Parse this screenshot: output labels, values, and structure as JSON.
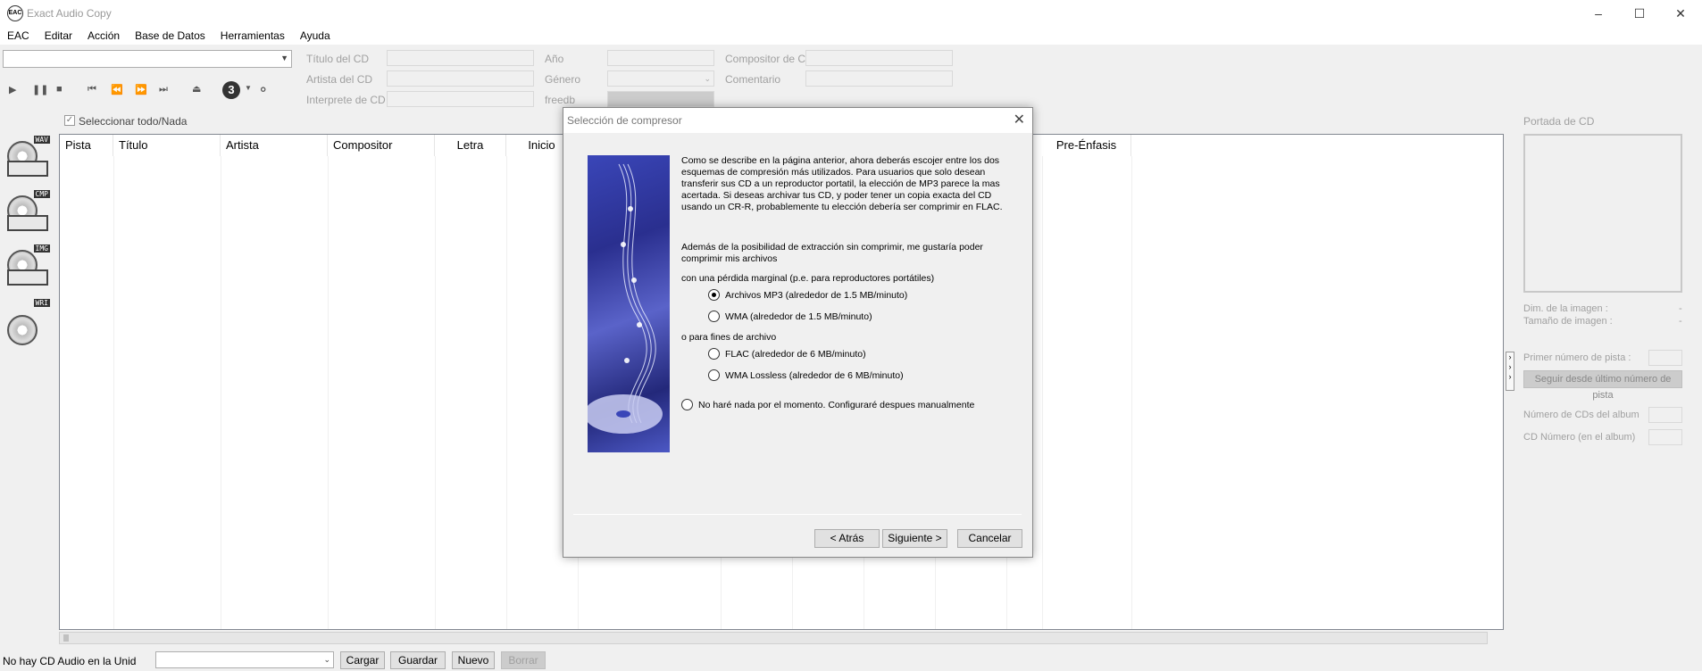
{
  "window": {
    "title": "Exact Audio Copy",
    "icon_label": "EAC"
  },
  "menu": [
    "EAC",
    "Editar",
    "Acción",
    "Base de Datos",
    "Herramientas",
    "Ayuda"
  ],
  "cd_fields": {
    "titulo": "Título del CD",
    "artista": "Artista del CD",
    "interprete": "Interprete de CD",
    "anio": "Año",
    "genero": "Género",
    "freedb": "freedb",
    "compositor": "Compositor de CD",
    "comentario": "Comentario"
  },
  "disc_number": "3",
  "select_all": "Seleccionar todo/Nada",
  "side_tags": [
    "WAV",
    "CMP",
    "IMG",
    "WRI"
  ],
  "columns": [
    "Pista",
    "Título",
    "Artista",
    "Compositor",
    "Letra",
    "Inicio",
    "Pre-Énfasis"
  ],
  "right_panel": {
    "cover": "Portada de CD",
    "dim_imagen": "Dim. de la imagen :",
    "tam_imagen": "Tamaño de imagen :",
    "dim_value": "-",
    "tam_value": "-",
    "primer_numero": "Primer número de pista :",
    "seguir_btn": "Seguir desde último número de pista",
    "num_cds": "Número de CDs del album",
    "cd_numero": "CD Número (en el album)"
  },
  "status": {
    "text": "No hay CD Audio en la Unida",
    "buttons": [
      "Cargar",
      "Guardar",
      "Nuevo",
      "Borrar"
    ]
  },
  "dialog": {
    "title": "Selección de compresor",
    "intro": "Como se describe en la página anterior, ahora deberás escojer entre los dos esquemas de compresión más utilizados. Para usuarios que solo desean transferir sus CD a un reproductor portatil, la elección de MP3 parece la mas acertada. Si deseas archivar tus CD, y poder tener un copia exacta del CD usando un CR-R, probablemente tu elección debería ser comprimir en FLAC.",
    "also": "Además de la posibilidad de extracción sin comprimir, me gustaría poder comprimir mis archivos",
    "lossy_heading": "con una pérdida marginal (p.e. para reproductores portátiles)",
    "opt_mp3": "Archivos MP3 (alrededor de 1.5 MB/minuto)",
    "opt_wma": "WMA (alrededor de 1.5 MB/minuto)",
    "archive_heading": "o para fines de archivo",
    "opt_flac": "FLAC (alrededor de 6 MB/minuto)",
    "opt_wmal": "WMA Lossless (alrededor de 6 MB/minuto)",
    "opt_none": "No haré nada por el momento. Configuraré despues manualmente",
    "selected": "mp3",
    "btn_back": "< Atrás",
    "btn_next": "Siguiente >",
    "btn_cancel": "Cancelar"
  }
}
